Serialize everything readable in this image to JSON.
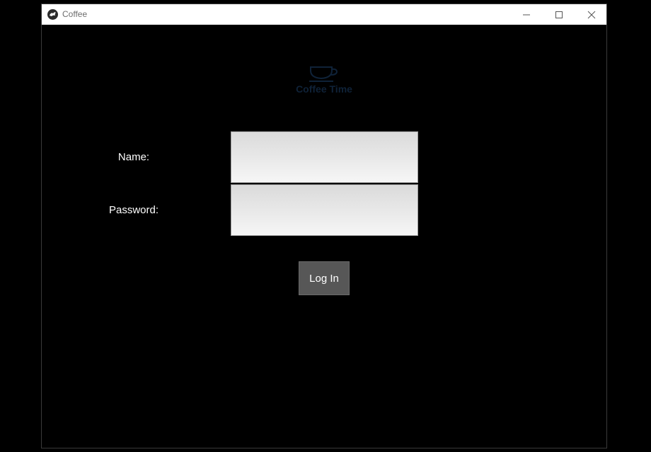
{
  "window": {
    "title": "Coffee",
    "icon": "kivy-app-icon",
    "controls": [
      "minimize-icon",
      "maximize-icon",
      "close-icon"
    ]
  },
  "logo": {
    "icon": "coffee-cup-icon",
    "text": "Coffee Time",
    "color": "#0f2238"
  },
  "form": {
    "name_label": "Name:",
    "name_value": "",
    "password_label": "Password:",
    "password_value": "",
    "login_label": "Log In"
  },
  "colors": {
    "background": "#000000",
    "button": "#575757",
    "text": "#ffffff"
  }
}
